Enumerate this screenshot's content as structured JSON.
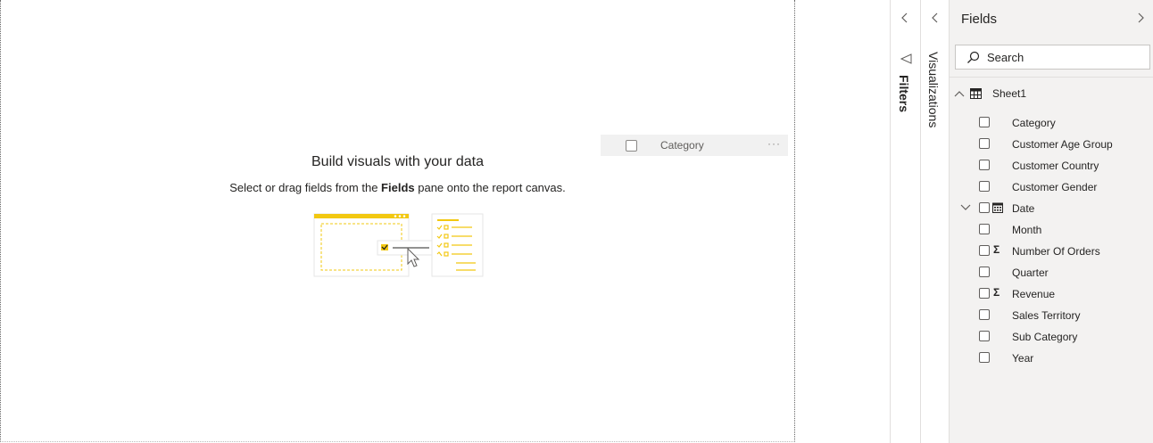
{
  "canvas": {
    "empty_title": "Build visuals with your data",
    "empty_sub_before": "Select or drag fields from the ",
    "empty_sub_bold": "Fields",
    "empty_sub_after": " pane onto the report canvas.",
    "drag_chip_label": "Category",
    "drag_chip_more": "···"
  },
  "filters": {
    "label": "Filters",
    "collapse_icon": "chevron-left"
  },
  "visualizations": {
    "label": "Visualizations",
    "collapse_icon": "chevron-left"
  },
  "fields": {
    "title": "Fields",
    "search_placeholder": "Search",
    "table_name": "Sheet1",
    "items": [
      {
        "label": "Category",
        "icon": ""
      },
      {
        "label": "Customer Age Group",
        "icon": ""
      },
      {
        "label": "Customer Country",
        "icon": ""
      },
      {
        "label": "Customer Gender",
        "icon": ""
      },
      {
        "label": "Date",
        "icon": "calendar",
        "expandable": true
      },
      {
        "label": "Month",
        "icon": ""
      },
      {
        "label": "Number Of Orders",
        "icon": "sigma"
      },
      {
        "label": "Quarter",
        "icon": ""
      },
      {
        "label": "Revenue",
        "icon": "sigma"
      },
      {
        "label": "Sales Territory",
        "icon": ""
      },
      {
        "label": "Sub Category",
        "icon": ""
      },
      {
        "label": "Year",
        "icon": ""
      }
    ]
  },
  "colors": {
    "accent": "#f2c811",
    "pane_bg": "#f3f2f1"
  }
}
